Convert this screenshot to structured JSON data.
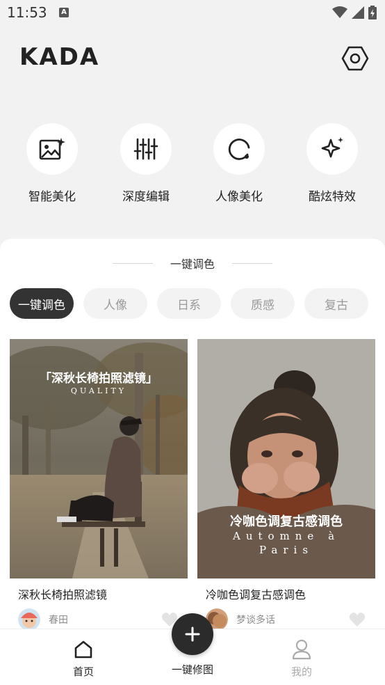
{
  "status_bar": {
    "time": "11:53",
    "notification_badge": "A"
  },
  "header": {
    "logo": "KADA",
    "settings_icon": "hexagon-gear-icon"
  },
  "tools": [
    {
      "label": "智能美化",
      "icon": "image-sparkle-icon"
    },
    {
      "label": "深度编辑",
      "icon": "sliders-icon"
    },
    {
      "label": "人像美化",
      "icon": "portrait-circle-icon"
    },
    {
      "label": "酷炫特效",
      "icon": "sparkle-icon"
    }
  ],
  "section": {
    "title": "一键调色"
  },
  "chips": [
    {
      "label": "一键调色",
      "active": true
    },
    {
      "label": "人像",
      "active": false
    },
    {
      "label": "日系",
      "active": false
    },
    {
      "label": "质感",
      "active": false
    },
    {
      "label": "复古",
      "active": false
    }
  ],
  "cards": [
    {
      "title": "深秋长椅拍照滤镜",
      "overlay_title": "「深秋长椅拍照滤镜」",
      "overlay_sub": "QUALITY",
      "author": "春田"
    },
    {
      "title": "冷咖色调复古感调色",
      "overlay_title": "冷咖色调复古感调色",
      "overlay_sub_line1": "Automne à",
      "overlay_sub_line2": "Paris",
      "author": "梦谈多话"
    }
  ],
  "bottom_nav": {
    "home": "首页",
    "fab": "一键修图",
    "mine": "我的"
  },
  "colors": {
    "accent": "#333333",
    "background": "#f2f2f2",
    "chip_inactive": "#f3f3f3"
  }
}
